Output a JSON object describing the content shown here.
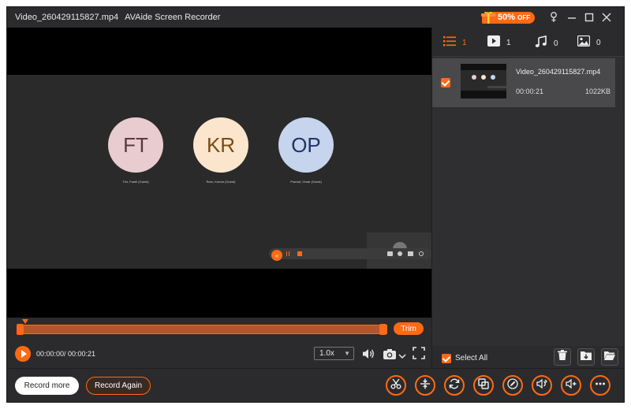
{
  "titlebar": {
    "filename": "Video_260429115827.mp4",
    "app_name": "AVAide Screen Recorder",
    "promo": {
      "value": "50%",
      "suffix": "OFF"
    }
  },
  "preview": {
    "participants": [
      {
        "initials": "FT",
        "name": "Tim, Farell (Guest)",
        "bg": "#e8ccd0",
        "fg": "#5a3a3d"
      },
      {
        "initials": "KR",
        "name": "Ram, Kumar (Guest)",
        "bg": "#fbe6cd",
        "fg": "#7a4a16"
      },
      {
        "initials": "OP",
        "name": "Pramot, Omar (Guest)",
        "bg": "#c7d4ee",
        "fg": "#1f3566"
      }
    ]
  },
  "timeline": {
    "trim_label": "Trim"
  },
  "player": {
    "time": "00:00:00/ 00:00:21",
    "speed": "1.0x"
  },
  "media_tabs": [
    {
      "icon": "list-icon",
      "count": "1"
    },
    {
      "icon": "video-icon",
      "count": "1"
    },
    {
      "icon": "audio-icon",
      "count": "0"
    },
    {
      "icon": "image-icon",
      "count": "0"
    }
  ],
  "recordings": [
    {
      "name": "Video_260429115827.mp4",
      "duration": "00:00:21",
      "size": "1022KB",
      "checked": true
    }
  ],
  "list_footer": {
    "select_all": "Select All"
  },
  "bottom": {
    "record_more": "Record more",
    "record_again": "Record Again"
  },
  "colors": {
    "accent": "#ff6a13",
    "panel": "#2b2b2d",
    "selected_item": "#49494b"
  }
}
